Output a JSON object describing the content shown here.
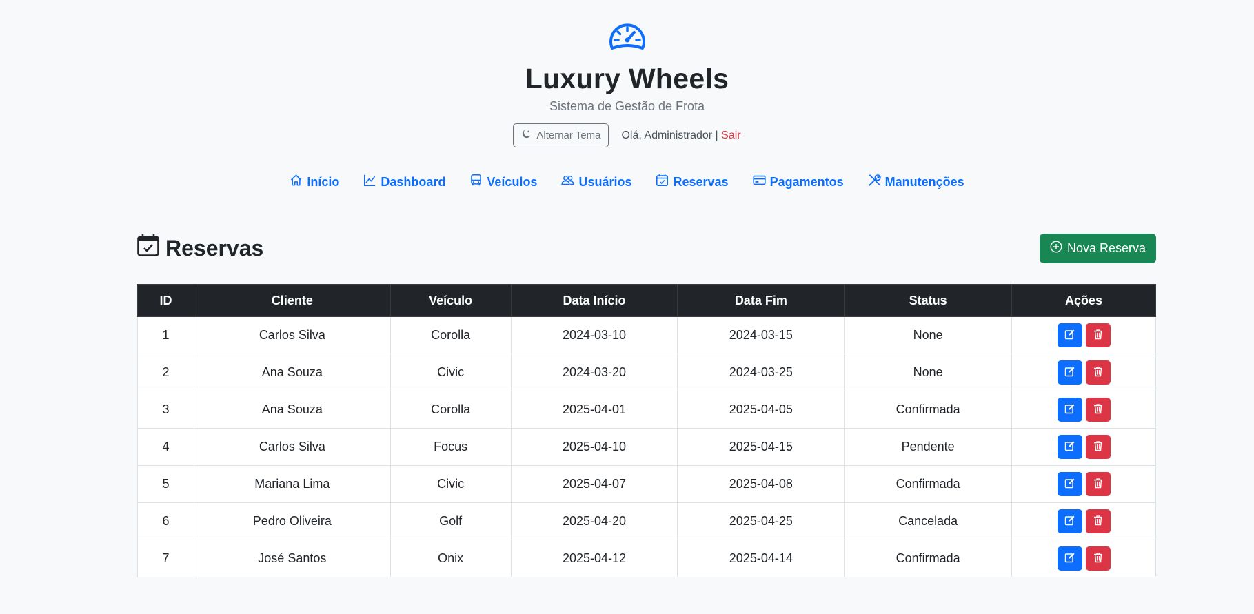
{
  "brand": {
    "title": "Luxury Wheels",
    "subtitle": "Sistema de Gestão de Frota",
    "logo_icon": "speedometer-icon"
  },
  "user_bar": {
    "theme_button": "Alternar Tema",
    "greeting": "Olá, Administrador |",
    "logout": "Sair"
  },
  "nav": [
    {
      "label": "Início",
      "icon": "house-icon"
    },
    {
      "label": "Dashboard",
      "icon": "graph-icon"
    },
    {
      "label": "Veículos",
      "icon": "bus-icon"
    },
    {
      "label": "Usuários",
      "icon": "people-icon"
    },
    {
      "label": "Reservas",
      "icon": "calendar-check-icon"
    },
    {
      "label": "Pagamentos",
      "icon": "credit-card-icon"
    },
    {
      "label": "Manutenções",
      "icon": "tools-icon"
    }
  ],
  "page": {
    "title": "Reservas",
    "new_button": "Nova Reserva"
  },
  "table": {
    "headers": [
      "ID",
      "Cliente",
      "Veículo",
      "Data Início",
      "Data Fim",
      "Status",
      "Ações"
    ],
    "rows": [
      [
        "1",
        "Carlos Silva",
        "Corolla",
        "2024-03-10",
        "2024-03-15",
        "None"
      ],
      [
        "2",
        "Ana Souza",
        "Civic",
        "2024-03-20",
        "2024-03-25",
        "None"
      ],
      [
        "3",
        "Ana Souza",
        "Corolla",
        "2025-04-01",
        "2025-04-05",
        "Confirmada"
      ],
      [
        "4",
        "Carlos Silva",
        "Focus",
        "2025-04-10",
        "2025-04-15",
        "Pendente"
      ],
      [
        "5",
        "Mariana Lima",
        "Civic",
        "2025-04-07",
        "2025-04-08",
        "Confirmada"
      ],
      [
        "6",
        "Pedro Oliveira",
        "Golf",
        "2025-04-20",
        "2025-04-25",
        "Cancelada"
      ],
      [
        "7",
        "José Santos",
        "Onix",
        "2025-04-12",
        "2025-04-14",
        "Confirmada"
      ]
    ]
  },
  "colors": {
    "primary": "#0d6efd",
    "success": "#198754",
    "danger": "#dc3545",
    "dark": "#212529",
    "background": "#f8f9fa"
  }
}
